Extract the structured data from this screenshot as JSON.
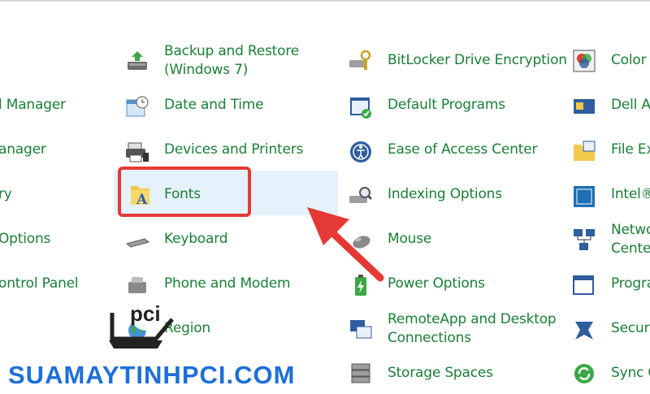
{
  "columns": {
    "col0": [
      {
        "label": "l Manager"
      },
      {
        "label": "anager"
      },
      {
        "label": "ry"
      },
      {
        "label": "Options"
      },
      {
        "label": "ontrol Panel"
      }
    ],
    "col1": [
      {
        "label_line1": "Backup and Restore",
        "label_line2": "(Windows 7)",
        "icon": "backup-restore-icon"
      },
      {
        "label": "Date and Time",
        "icon": "date-time-icon"
      },
      {
        "label": "Devices and Printers",
        "icon": "devices-printers-icon"
      },
      {
        "label": "Fonts",
        "icon": "fonts-icon"
      },
      {
        "label": "Keyboard",
        "icon": "keyboard-icon"
      },
      {
        "label": "Phone and Modem",
        "icon": "phone-modem-icon"
      },
      {
        "label": "Region",
        "icon": "region-icon"
      }
    ],
    "col2": [
      {
        "label": "BitLocker Drive Encryption",
        "icon": "bitlocker-icon"
      },
      {
        "label": "Default Programs",
        "icon": "default-programs-icon"
      },
      {
        "label": "Ease of Access Center",
        "icon": "ease-of-access-icon"
      },
      {
        "label": "Indexing Options",
        "icon": "indexing-icon"
      },
      {
        "label": "Mouse",
        "icon": "mouse-icon"
      },
      {
        "label": "Power Options",
        "icon": "power-options-icon"
      },
      {
        "label_line1": "RemoteApp and Desktop",
        "label_line2": "Connections",
        "icon": "remoteapp-icon"
      },
      {
        "label": "Storage Spaces",
        "icon": "storage-spaces-icon"
      }
    ],
    "col3": [
      {
        "label": "Color",
        "icon": "color-icon"
      },
      {
        "label": "Dell A",
        "icon": "dell-icon"
      },
      {
        "label": "File Ex",
        "icon": "file-explorer-icon"
      },
      {
        "label": "Intel®",
        "icon": "intel-icon"
      },
      {
        "label_line1": "Netwo",
        "label_line2": "Cente",
        "icon": "network-icon"
      },
      {
        "label": "Progra",
        "icon": "programs-icon"
      },
      {
        "label": "Securi",
        "icon": "security-icon"
      },
      {
        "label": "Sync C",
        "icon": "sync-icon"
      }
    ]
  },
  "watermark": {
    "text": "SUAMAYTINHPCI.COM",
    "logo_text": "pci"
  },
  "colors": {
    "link": "#1a7f37",
    "highlight": "#e5f1fb",
    "annotation": "#e53935",
    "watermark": "#1e6fd9"
  }
}
